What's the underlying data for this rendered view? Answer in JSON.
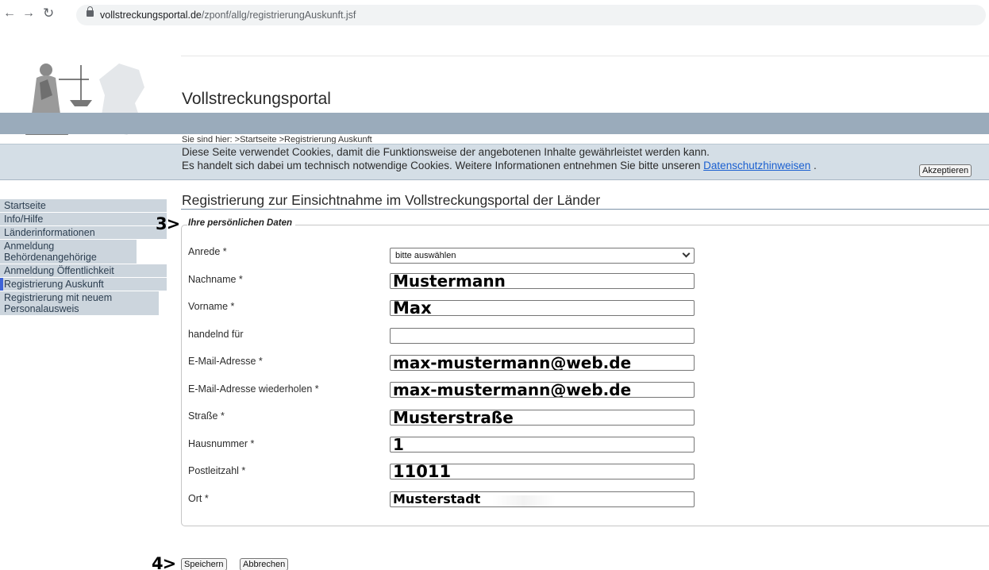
{
  "browser": {
    "url_host": "vollstreckungsportal.de",
    "url_path": "/zponf/allg/registrierungAuskunft.jsf"
  },
  "site": {
    "title": "Vollstreckungsportal",
    "breadcrumb": "Sie sind hier:  >Startseite   >Registrierung Auskunft"
  },
  "cookie": {
    "line1": "Diese Seite verwendet Cookies, damit die Funktionsweise der angebotenen Inhalte gewährleistet werden kann.",
    "line2": "Es handelt sich dabei um technisch notwendige Cookies. Weitere Informationen entnehmen Sie bitte unseren",
    "link": "Datenschutzhinweisen",
    "after_link": " .",
    "accept": "Akzeptieren"
  },
  "sidebar": {
    "items": [
      {
        "label": "Startseite"
      },
      {
        "label": "Info/Hilfe"
      },
      {
        "label": "Länderinformationen"
      },
      {
        "label": "Anmeldung Behördenangehörige"
      },
      {
        "label": "Anmeldung Öffentlichkeit"
      },
      {
        "label": "Registrierung Auskunft"
      },
      {
        "label": "Registrierung mit neuem Personalausweis"
      }
    ]
  },
  "main": {
    "heading": "Registrierung zur Einsichtnahme im Vollstreckungsportal der Länder",
    "marker3": "3>",
    "marker4": "4>",
    "legend": "Ihre persönlichen Daten"
  },
  "form": {
    "anrede": {
      "label": "Anrede *",
      "value": "bitte auswählen"
    },
    "nachname": {
      "label": "Nachname *",
      "value": "Mustermann"
    },
    "vorname": {
      "label": "Vorname *",
      "value": "Max"
    },
    "handelnd": {
      "label": "handelnd für",
      "value": ""
    },
    "email": {
      "label": "E-Mail-Adresse *",
      "value": "max-mustermann@web.de"
    },
    "email2": {
      "label": "E-Mail-Adresse wiederholen *",
      "value": "max-mustermann@web.de"
    },
    "strasse": {
      "label": "Straße *",
      "value": "Musterstraße"
    },
    "hausnummer": {
      "label": "Hausnummer *",
      "value": "1"
    },
    "plz": {
      "label": "Postleitzahl *",
      "value": "11011"
    },
    "ort": {
      "label": "Ort *",
      "value": "Musterstadt"
    }
  },
  "buttons": {
    "save": "Speichern",
    "cancel": "Abbrechen"
  }
}
